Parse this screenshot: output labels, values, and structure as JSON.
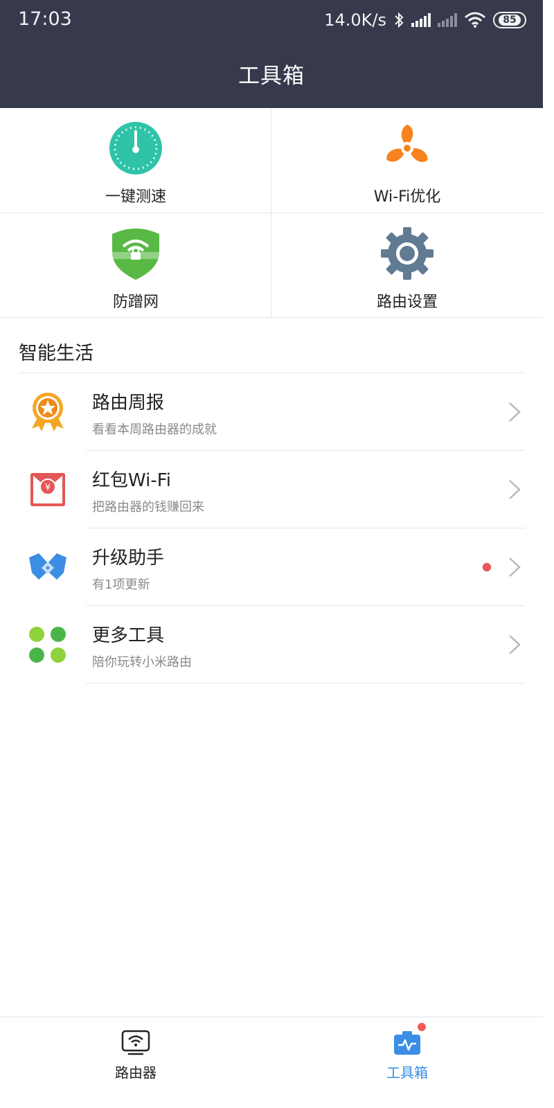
{
  "status_bar": {
    "time": "17:03",
    "network_speed": "14.0K/s",
    "battery": "85",
    "icons": [
      "bluetooth-icon",
      "signal-icon",
      "signal-icon",
      "wifi-icon",
      "battery-icon"
    ]
  },
  "header": {
    "title": "工具箱"
  },
  "tools": [
    {
      "label": "一键测速",
      "icon": "speedometer-icon",
      "color": "#2fc3a8"
    },
    {
      "label": "Wi-Fi优化",
      "icon": "fan-icon",
      "color": "#f7821e"
    },
    {
      "label": "防蹭网",
      "icon": "wifi-shield-icon",
      "color": "#59b945"
    },
    {
      "label": "路由设置",
      "icon": "gear-icon",
      "color": "#607b92"
    }
  ],
  "smart_life": {
    "title": "智能生活",
    "items": [
      {
        "title": "路由周报",
        "subtitle": "看看本周路由器的成就",
        "icon": "medal-icon",
        "badge": false
      },
      {
        "title": "红包Wi-Fi",
        "subtitle": "把路由器的钱赚回来",
        "icon": "red-envelope-icon",
        "badge": false
      },
      {
        "title": "升级助手",
        "subtitle": "有1项更新",
        "icon": "upgrade-icon",
        "badge": true
      },
      {
        "title": "更多工具",
        "subtitle": "陪你玩转小米路由",
        "icon": "dots-grid-icon",
        "badge": false
      }
    ]
  },
  "bottom_nav": {
    "items": [
      {
        "label": "路由器",
        "icon": "router-icon",
        "active": false
      },
      {
        "label": "工具箱",
        "icon": "toolbox-icon",
        "active": true
      }
    ],
    "active_color": "#3a8ee6",
    "inactive_color": "#222222"
  }
}
